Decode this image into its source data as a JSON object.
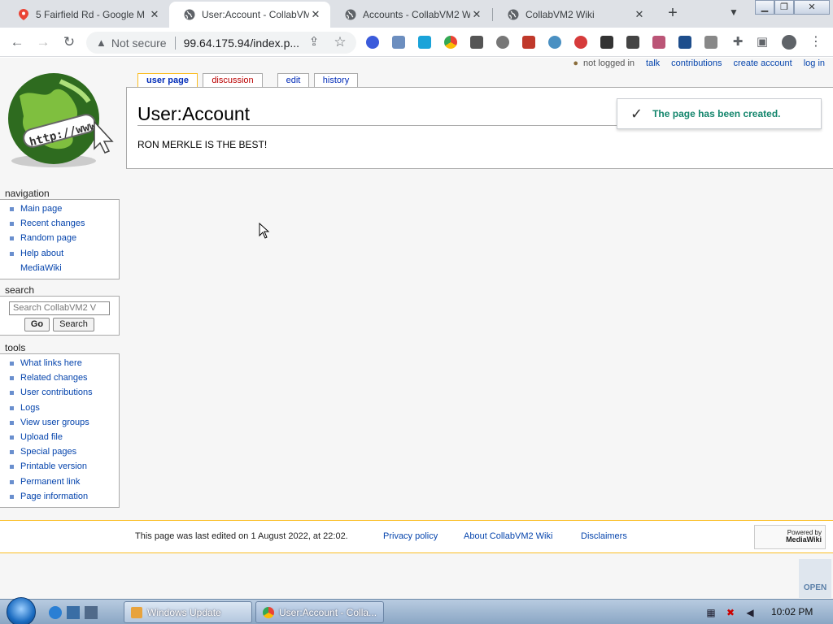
{
  "browser": {
    "tabs": [
      {
        "label": "5 Fairfield Rd - Google M",
        "icon": "maps-pin-icon"
      },
      {
        "label": "User:Account - CollabVM",
        "icon": "globe-icon"
      },
      {
        "label": "Accounts - CollabVM2 W",
        "icon": "globe-icon"
      },
      {
        "label": "CollabVM2 Wiki",
        "icon": "globe-icon"
      }
    ],
    "security_label": "Not secure",
    "url": "99.64.175.94/index.p..."
  },
  "wiki": {
    "personal": {
      "not_logged_in": "not logged in",
      "talk": "talk",
      "contributions": "contributions",
      "create_account": "create account",
      "log_in": "log in"
    },
    "logo_text": "http://www",
    "tabs": {
      "user_page": "user page",
      "discussion": "discussion",
      "edit": "edit",
      "history": "history"
    },
    "title": "User:Account",
    "body": "RON MERKLE IS THE BEST!",
    "notification": "The page has been created.",
    "navigation": {
      "heading": "navigation",
      "items": [
        "Main page",
        "Recent changes",
        "Random page",
        "Help about MediaWiki"
      ]
    },
    "search": {
      "heading": "search",
      "placeholder": "Search CollabVM2 V",
      "go": "Go",
      "search": "Search"
    },
    "tools": {
      "heading": "tools",
      "items": [
        "What links here",
        "Related changes",
        "User contributions",
        "Logs",
        "View user groups",
        "Upload file",
        "Special pages",
        "Printable version",
        "Permanent link",
        "Page information"
      ]
    },
    "footer": {
      "last_edited": "This page was last edited on 1 August 2022, at 22:02.",
      "privacy": "Privacy policy",
      "about": "About CollabVM2 Wiki",
      "disclaimers": "Disclaimers",
      "powered_by": "Powered by",
      "mediawiki": "MediaWiki"
    },
    "mn_open": "OPEN"
  },
  "taskbar": {
    "tasks": [
      "Windows Update",
      "User:Account - Colla..."
    ],
    "clock": "10:02 PM"
  }
}
